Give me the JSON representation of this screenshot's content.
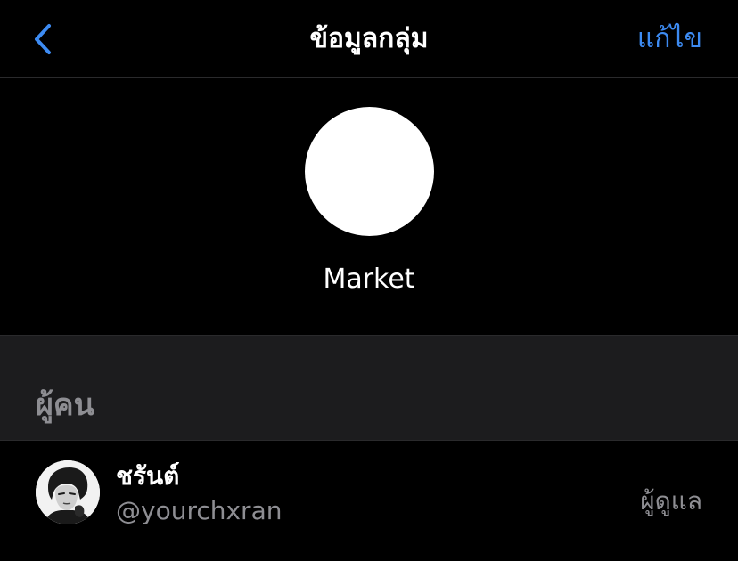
{
  "nav": {
    "title": "ข้อมูลกลุ่ม",
    "edit_label": "แก้ไข",
    "back_icon": "chevron-left-icon",
    "accent_color": "#3d8bf2"
  },
  "group": {
    "name": "Market",
    "avatar_color": "#ffffff"
  },
  "people_section": {
    "header": "ผู้คน",
    "members": [
      {
        "display_name": "ชรันต์",
        "handle": "@yourchxran",
        "role": "ผู้ดูแล"
      }
    ]
  }
}
